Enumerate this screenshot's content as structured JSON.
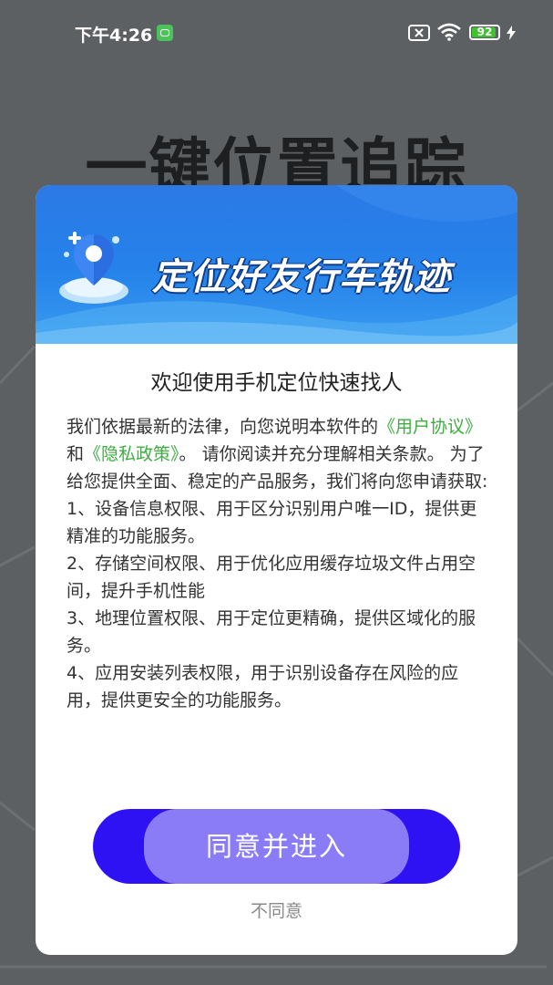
{
  "status_bar": {
    "time": "下午4:26",
    "battery_level": "92",
    "battery_percent": 92
  },
  "background": {
    "title": "一键位置追踪"
  },
  "dialog": {
    "banner_text": "定位好友行车轨迹",
    "title": "欢迎使用手机定位快速找人",
    "body": {
      "intro_before": "我们依据最新的法律，向您说明本软件的",
      "user_agreement_link": "《用户协议》",
      "and": "和",
      "privacy_policy_link": "《隐私政策》",
      "intro_after": "。 请你阅读并充分理解相关条款。 为了给您提供全面、稳定的产品服务，我们将向您申请获取:",
      "items": [
        "1、设备信息权限、用于区分识别用户唯一ID，提供更精准的功能服务。",
        "2、存储空间权限、用于优化应用缓存垃圾文件占用空间，提升手机性能",
        "3、地理位置权限、用于定位更精确，提供区域化的服务。",
        "4、应用安装列表权限，用于识别设备存在风险的应用，提供更安全的功能服务。"
      ]
    },
    "agree_label": "同意并进入",
    "disagree_label": "不同意"
  },
  "colors": {
    "link": "#3dae3f",
    "agree_button": "#2f12f4",
    "agree_button_center": "#8a7cf7",
    "banner": "#2583ea"
  }
}
